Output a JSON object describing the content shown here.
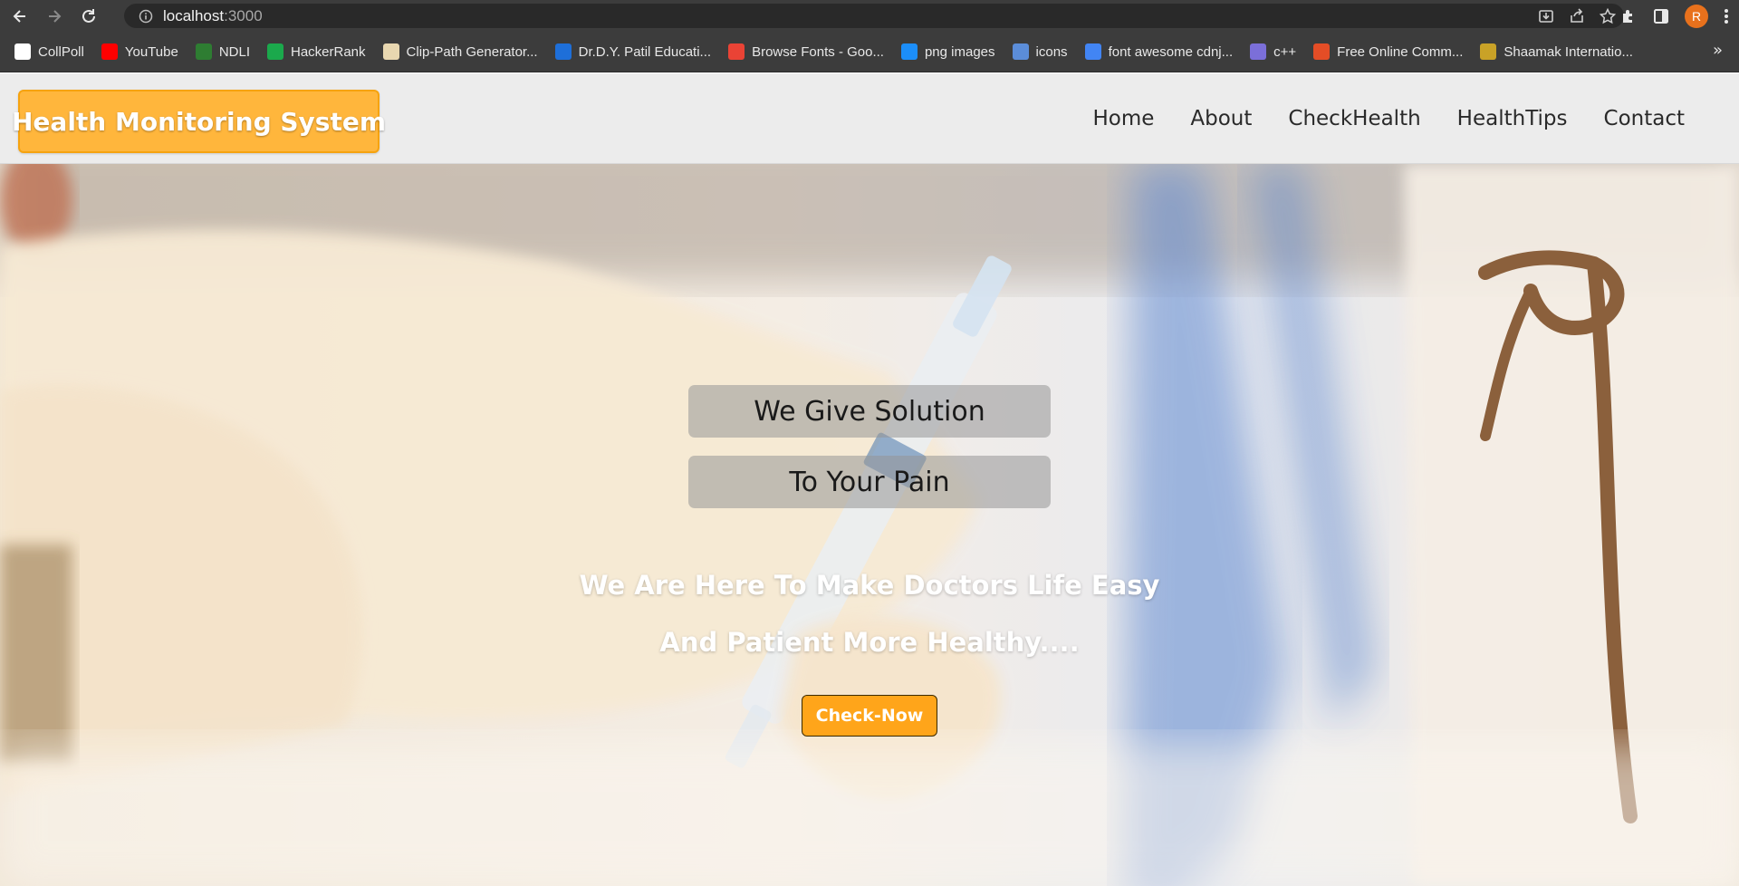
{
  "browser": {
    "url_host": "localhost",
    "url_port": ":3000",
    "profile_initial": "R",
    "bookmarks": [
      {
        "label": "CollPoll",
        "icon": "collpoll-icon",
        "color": "#ffffff"
      },
      {
        "label": "YouTube",
        "icon": "youtube-icon",
        "color": "#ff0000"
      },
      {
        "label": "NDLI",
        "icon": "ndli-icon",
        "color": "#2e7d32"
      },
      {
        "label": "HackerRank",
        "icon": "hackerrank-icon",
        "color": "#1ba94c"
      },
      {
        "label": "Clip-Path Generator...",
        "icon": "clip-path-icon",
        "color": "#e8d7b0"
      },
      {
        "label": "Dr.D.Y. Patil Educati...",
        "icon": "dypatil-icon",
        "color": "#1e6fd9"
      },
      {
        "label": "Browse Fonts - Goo...",
        "icon": "google-fonts-icon",
        "color": "#ea4335"
      },
      {
        "label": "png images",
        "icon": "pngwing-icon",
        "color": "#1c8ef9"
      },
      {
        "label": "icons",
        "icon": "flag-icon",
        "color": "#5b8dd9"
      },
      {
        "label": "font awesome cdnj...",
        "icon": "google-icon",
        "color": "#4285f4"
      },
      {
        "label": "c++",
        "icon": "cpp-icon",
        "color": "#7b6fd9"
      },
      {
        "label": "Free Online Comm...",
        "icon": "multicolor-icon",
        "color": "#e44d26"
      },
      {
        "label": "Shaamak Internatio...",
        "icon": "shaamak-icon",
        "color": "#c9a227"
      }
    ],
    "more_bookmarks": "»"
  },
  "site": {
    "brand": "Health Monitoring System",
    "nav": [
      "Home",
      "About",
      "CheckHealth",
      "HealthTips",
      "Contact"
    ]
  },
  "hero": {
    "tagline_1": "We Give Solution",
    "tagline_2": "To Your Pain",
    "subline_1": "We Are Here To Make Doctors Life Easy",
    "subline_2": "And Patient More Healthy....",
    "cta_label": "Check-Now"
  },
  "colors": {
    "brand_bg": "#ffb63c",
    "cta_bg": "#ffa51a",
    "header_bg": "#ececec",
    "chrome_bg": "#3c3c3c"
  }
}
